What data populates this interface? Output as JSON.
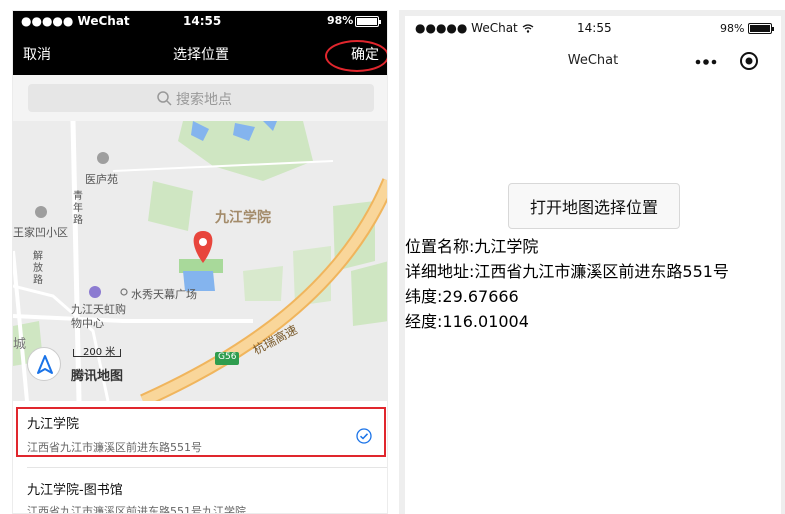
{
  "left": {
    "status": {
      "carrier": "●●●●● WeChat",
      "time": "14:55",
      "battery": "98%",
      "battery_level": 0.98
    },
    "nav": {
      "cancel": "取消",
      "title": "选择位置",
      "confirm": "确定"
    },
    "search": {
      "placeholder": "搜索地点"
    },
    "map": {
      "poi_title": "九江学院",
      "labels": {
        "yilu": "医庐苑",
        "qingnian": "青年路",
        "wangjia": "王家凹小区",
        "jiefang": "解放路",
        "plaza": "水秀天幕广场",
        "mall": "九江天虹购物中心",
        "cheng": "城",
        "hangrui": "杭瑞高速",
        "g56": "G56"
      },
      "scale": "200 米",
      "logo": "腾讯地图"
    },
    "results": [
      {
        "name": "九江学院",
        "address": "江西省九江市濂溪区前进东路551号",
        "selected": true
      },
      {
        "name": "九江学院-图书馆",
        "address": "江西省九江市濂溪区前进东路551号九江学院"
      }
    ]
  },
  "right": {
    "status": {
      "carrier": "●●●●● WeChat",
      "time": "14:55",
      "battery": "98%",
      "battery_level": 0.98
    },
    "nav": {
      "title": "WeChat"
    },
    "button": "打开地图选择位置",
    "info": {
      "name": "位置名称:九江学院",
      "address": "详细地址:江西省九江市濂溪区前进东路551号",
      "latitude": "纬度:29.67666",
      "longitude": "经度:116.01004"
    }
  },
  "colors": {
    "highlight": "#e0262d",
    "pin": "#e8453c",
    "check": "#1a73e8",
    "road": "#f5cb84"
  }
}
